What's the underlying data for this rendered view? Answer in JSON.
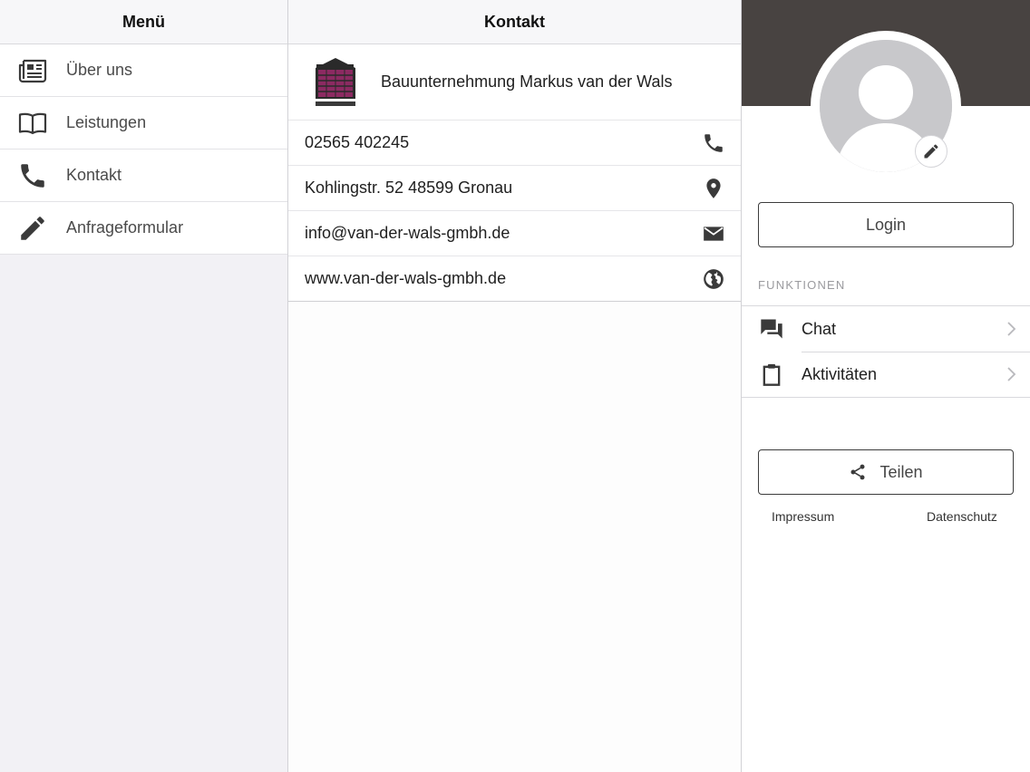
{
  "menu": {
    "title": "Menü",
    "items": [
      {
        "label": "Über uns",
        "icon": "newspaper-icon"
      },
      {
        "label": "Leistungen",
        "icon": "book-icon"
      },
      {
        "label": "Kontakt",
        "icon": "phone-icon"
      },
      {
        "label": "Anfrageformular",
        "icon": "pencil-icon"
      }
    ]
  },
  "contact": {
    "title": "Kontakt",
    "company_name": "Bauunternehmung Markus van der Wals",
    "rows": [
      {
        "text": "02565 402245",
        "icon": "phone-icon"
      },
      {
        "text": "Kohlingstr. 52 48599 Gronau",
        "icon": "map-pin-icon"
      },
      {
        "text": "info@van-der-wals-gmbh.de",
        "icon": "mail-icon"
      },
      {
        "text": "www.van-der-wals-gmbh.de",
        "icon": "globe-icon"
      }
    ]
  },
  "profile": {
    "login_label": "Login",
    "section_label": "FUNKTIONEN",
    "functions": [
      {
        "label": "Chat",
        "icon": "chat-icon"
      },
      {
        "label": "Aktivitäten",
        "icon": "clipboard-icon"
      }
    ],
    "share_label": "Teilen",
    "footer": {
      "impressum": "Impressum",
      "datenschutz": "Datenschutz"
    }
  },
  "colors": {
    "banner": "#484341",
    "sidebar_bg": "#f2f1f5",
    "icon_dark": "#3a3a3a",
    "logo_accent": "#8c2a62"
  }
}
